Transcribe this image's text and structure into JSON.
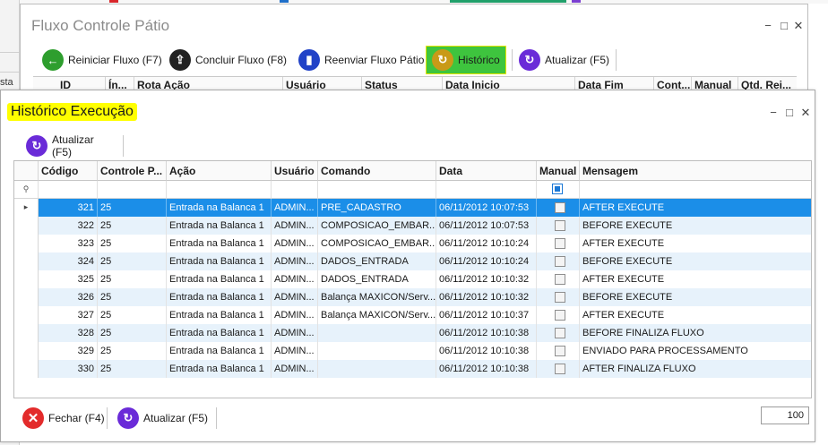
{
  "background": {
    "left_label": "sta",
    "accents": [
      "#d8262b",
      "#1f6fc9",
      "#21a06b",
      "#7b3fd1"
    ]
  },
  "back_window": {
    "title": "Fluxo Controle Pátio",
    "toolbar": [
      {
        "label": "Reiniciar Fluxo (F7)",
        "icon": "arrow-left-icon",
        "color": "#2e9e2e"
      },
      {
        "label": "Concluir Fluxo (F8)",
        "icon": "upload-icon",
        "color": "#222222"
      },
      {
        "label": "Reenviar Fluxo Pátio",
        "icon": "document-icon",
        "color": "#2142c7"
      },
      {
        "label": "Histórico",
        "icon": "history-icon",
        "color": "#c99a18",
        "highlight": "#3ec43e"
      },
      {
        "label": "Atualizar (F5)",
        "icon": "refresh-icon",
        "color": "#6a2bd8"
      }
    ],
    "columns": [
      "ID",
      "Ín...",
      "Rota Ação",
      "Usuário",
      "Status",
      "Data Inicio",
      "Data Fim",
      "Cont...",
      "Manual",
      "Qtd. Rei..."
    ]
  },
  "front_window": {
    "title": "Histórico Execução",
    "title_highlight": "#ffff00",
    "toolbar": {
      "refresh_label": "Atualizar (F5)"
    },
    "grid": {
      "columns": [
        "Código",
        "Controle P...",
        "Ação",
        "Usuário",
        "Comando",
        "Data",
        "Manual",
        "Mensagem"
      ],
      "filter_manual_checked": true,
      "selected_color": "#1b8ee8",
      "band_color": "#e7f2fb",
      "rows": [
        {
          "codigo": "321",
          "controle": "25",
          "acao": "Entrada na Balanca 1",
          "usuario": "ADMIN...",
          "comando": "PRE_CADASTRO",
          "data": "06/11/2012 10:07:53",
          "manual": false,
          "mensagem": "AFTER EXECUTE",
          "selected": true
        },
        {
          "codigo": "322",
          "controle": "25",
          "acao": "Entrada na Balanca 1",
          "usuario": "ADMIN...",
          "comando": "COMPOSICAO_EMBAR...",
          "data": "06/11/2012 10:07:53",
          "manual": false,
          "mensagem": "BEFORE EXECUTE",
          "selected": false
        },
        {
          "codigo": "323",
          "controle": "25",
          "acao": "Entrada na Balanca 1",
          "usuario": "ADMIN...",
          "comando": "COMPOSICAO_EMBAR...",
          "data": "06/11/2012 10:10:24",
          "manual": false,
          "mensagem": "AFTER EXECUTE",
          "selected": false
        },
        {
          "codigo": "324",
          "controle": "25",
          "acao": "Entrada na Balanca 1",
          "usuario": "ADMIN...",
          "comando": "DADOS_ENTRADA",
          "data": "06/11/2012 10:10:24",
          "manual": false,
          "mensagem": "BEFORE EXECUTE",
          "selected": false
        },
        {
          "codigo": "325",
          "controle": "25",
          "acao": "Entrada na Balanca 1",
          "usuario": "ADMIN...",
          "comando": "DADOS_ENTRADA",
          "data": "06/11/2012 10:10:32",
          "manual": false,
          "mensagem": "AFTER EXECUTE",
          "selected": false
        },
        {
          "codigo": "326",
          "controle": "25",
          "acao": "Entrada na Balanca 1",
          "usuario": "ADMIN...",
          "comando": "Balança MAXICON/Serv...",
          "data": "06/11/2012 10:10:32",
          "manual": false,
          "mensagem": "BEFORE EXECUTE",
          "selected": false
        },
        {
          "codigo": "327",
          "controle": "25",
          "acao": "Entrada na Balanca 1",
          "usuario": "ADMIN...",
          "comando": "Balança MAXICON/Serv...",
          "data": "06/11/2012 10:10:37",
          "manual": false,
          "mensagem": "AFTER EXECUTE",
          "selected": false
        },
        {
          "codigo": "328",
          "controle": "25",
          "acao": "Entrada na Balanca 1",
          "usuario": "ADMIN...",
          "comando": "",
          "data": "06/11/2012 10:10:38",
          "manual": false,
          "mensagem": "BEFORE FINALIZA FLUXO",
          "selected": false
        },
        {
          "codigo": "329",
          "controle": "25",
          "acao": "Entrada na Balanca 1",
          "usuario": "ADMIN...",
          "comando": "",
          "data": "06/11/2012 10:10:38",
          "manual": false,
          "mensagem": "ENVIADO PARA PROCESSAMENTO",
          "selected": false
        },
        {
          "codigo": "330",
          "controle": "25",
          "acao": "Entrada na Balanca 1",
          "usuario": "ADMIN...",
          "comando": "",
          "data": "06/11/2012 10:10:38",
          "manual": false,
          "mensagem": "AFTER FINALIZA FLUXO",
          "selected": false
        }
      ]
    },
    "bottom": {
      "close_label": "Fechar (F4)",
      "refresh_label": "Atualizar (F5)",
      "zoom": "100"
    }
  }
}
